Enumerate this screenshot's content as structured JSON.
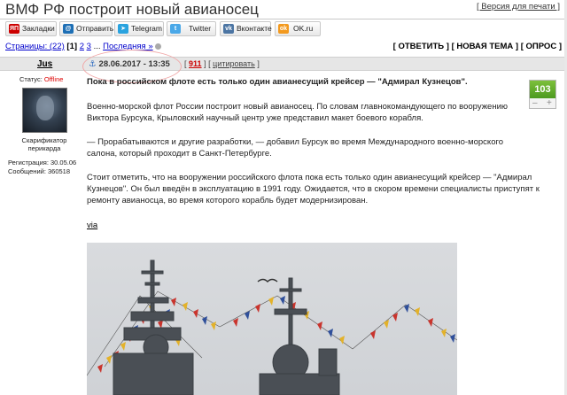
{
  "header": {
    "title": "ВМФ РФ построит новый авианосец",
    "print_label": "[ Версия для печати ]"
  },
  "share": [
    {
      "label": "Закладки",
      "icon": "yandex-icon",
      "icon_glyph": "ЯП",
      "color": "#cc0000"
    },
    {
      "label": "Отправить",
      "icon": "mail-icon",
      "icon_glyph": "@",
      "color": "#1e6fb5"
    },
    {
      "label": "Telegram",
      "icon": "telegram-icon",
      "icon_glyph": "➤",
      "color": "#2aa3df"
    },
    {
      "label": "Twitter",
      "icon": "twitter-icon",
      "icon_glyph": "t",
      "color": "#4aa8e8"
    },
    {
      "label": "Вконтакте",
      "icon": "vk-icon",
      "icon_glyph": "vk",
      "color": "#4c75a3"
    },
    {
      "label": "OK.ru",
      "icon": "ok-icon",
      "icon_glyph": "ok",
      "color": "#f39a1f"
    }
  ],
  "pager": {
    "label": "Страницы: (22)",
    "current": "[1]",
    "p2": "2",
    "p3": "3",
    "dots": "...",
    "last": "Последняя »"
  },
  "actions": {
    "reply": "[ ОТВЕТИТЬ ]",
    "new_topic": "[ НОВАЯ ТЕМА ]",
    "poll": "[ ОПРОС ]"
  },
  "post": {
    "author": "Jus",
    "date": "28.06.2017 - 13:35",
    "open_bracket": "[",
    "number": "911",
    "cite": "цитировать",
    "close_bracket": "]",
    "lead": "Пока в российском флоте есть только один авианесущий крейсер — \"Адмирал Кузнецов\".",
    "p1": "Военно-морской флот России построит новый авианосец. По словам главнокомандующего по вооружению Виктора Бурсука, Крыловский научный центр уже представил макет боевого корабля.",
    "p2": "— Прорабатываются и другие разработки, — добавил Бурсук во время Международного военно-морского салона, который проходит в Санкт-Петербурге.",
    "p3": "Стоит отметить, что на вооружении российского флота пока есть только один авианесущий крейсер — \"Адмирал Кузнецов\". Он был введён в эксплуатацию в 1991 году. Ожидается, что в скором времени специалисты приступят к ремонту авианосца, во время которого корабль будет модернизирован.",
    "via": "via",
    "rating": "103",
    "vote_down": "–",
    "vote_up": "+"
  },
  "sidebar": {
    "status_label": "Статус:",
    "status_value": "Offline",
    "rank": "Скарификатор перикарда",
    "registration": "Регистрация: 30.05.06",
    "messages": "Сообщений: 360518"
  },
  "colors": {
    "rating_green": "#5aa62a",
    "offline_red": "#dd0000",
    "link_blue": "#0000cc",
    "annotation_circle": "#f1a8a8"
  }
}
